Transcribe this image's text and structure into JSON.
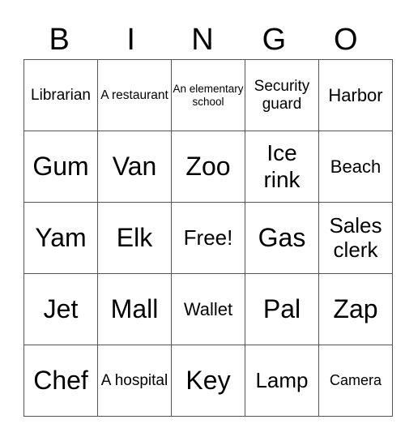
{
  "header": [
    "B",
    "I",
    "N",
    "G",
    "O"
  ],
  "rows": [
    [
      "Librarian",
      "A restaurant",
      "An elementary school",
      "Security guard",
      "Harbor"
    ],
    [
      "Gum",
      "Van",
      "Zoo",
      "Ice rink",
      "Beach"
    ],
    [
      "Yam",
      "Elk",
      "Free!",
      "Gas",
      "Sales clerk"
    ],
    [
      "Jet",
      "Mall",
      "Wallet",
      "Pal",
      "Zap"
    ],
    [
      "Chef",
      "A hospital",
      "Key",
      "Lamp",
      "Camera"
    ]
  ]
}
